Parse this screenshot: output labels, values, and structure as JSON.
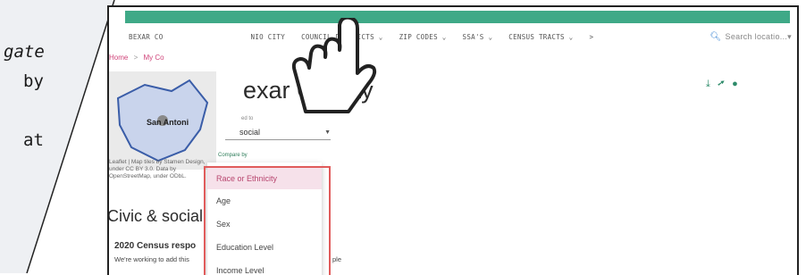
{
  "left_panel": {
    "line1": "gate",
    "line2": "by",
    "line3": "at"
  },
  "nav": {
    "items": [
      "BEXAR CO",
      "NIO CITY",
      "COUNCIL DISTRICTS ⌄",
      "ZIP CODES ⌄",
      "SSA'S ⌄",
      "CENSUS TRACTS ⌄",
      ">"
    ],
    "search_placeholder": "Search locatio...",
    "search_caret": "▾"
  },
  "breadcrumb": {
    "home": "Home",
    "sep": ">",
    "current": "My Co"
  },
  "map": {
    "place_label": "San Antoni",
    "attribution": "Leaflet | Map tiles by Stamen Design, under CC BY 3.0. Data by OpenStreetMap, under ODbL."
  },
  "page": {
    "title": "exar County"
  },
  "topic_select": {
    "label": "ed to",
    "value": "social"
  },
  "compare": {
    "label": "Compare by",
    "options": [
      "Race or Ethnicity",
      "Age",
      "Sex",
      "Education Level",
      "Income Level"
    ],
    "selected_index": 0
  },
  "section": {
    "title": "Civic & social",
    "card_title": "2020 Census respo",
    "card_text_a": "We're working to add this",
    "card_text_b": "ple"
  },
  "colors": {
    "accent_green": "#3fa987",
    "link_pink": "#d0457a",
    "highlight_red": "#e05b5b"
  }
}
